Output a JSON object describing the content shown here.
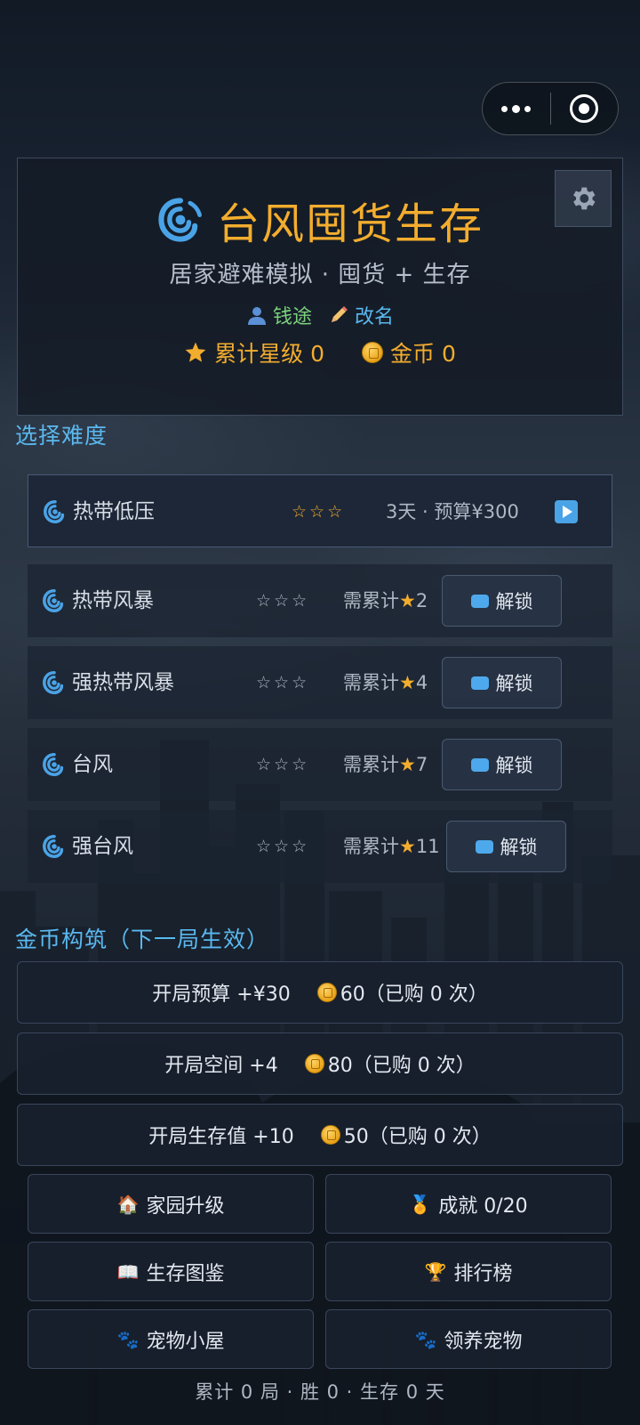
{
  "header": {
    "title": "台风囤货生存",
    "subtitle": "居家避难模拟 · 囤货 + 生存",
    "user_name": "钱途",
    "rename_label": "改名",
    "stars_label": "累计星级 0",
    "coins_label": "金币 0"
  },
  "difficulty": {
    "section_title": "选择难度",
    "levels": [
      {
        "name": "热带低压",
        "stars": "☆☆☆",
        "info": "3天 · 预算¥300",
        "state": "playable"
      },
      {
        "name": "热带风暴",
        "stars": "☆☆☆",
        "requirement_prefix": "需累计",
        "requirement_value": "2",
        "unlock_label": "解锁",
        "state": "locked"
      },
      {
        "name": "强热带风暴",
        "stars": "☆☆☆",
        "requirement_prefix": "需累计",
        "requirement_value": "4",
        "unlock_label": "解锁",
        "state": "locked"
      },
      {
        "name": "台风",
        "stars": "☆☆☆",
        "requirement_prefix": "需累计",
        "requirement_value": "7",
        "unlock_label": "解锁",
        "state": "locked"
      },
      {
        "name": "强台风",
        "stars": "☆☆☆",
        "requirement_prefix": "需累计",
        "requirement_value": "11",
        "unlock_label": "解锁",
        "state": "locked"
      }
    ]
  },
  "build": {
    "section_title": "金币构筑（下一局生效）",
    "items": [
      {
        "label": "开局预算 +¥30",
        "cost": "60（已购 0 次）"
      },
      {
        "label": "开局空间 +4",
        "cost": "80（已购 0 次）"
      },
      {
        "label": "开局生存值 +10",
        "cost": "50（已购 0 次）"
      }
    ]
  },
  "menu": {
    "home_upgrade": "家园升级",
    "achievements": "成就 0/20",
    "survival_guide": "生存图鉴",
    "leaderboard": "排行榜",
    "pet_house": "宠物小屋",
    "adopt_pet": "领养宠物"
  },
  "footer": {
    "summary": "累计 0 局 · 胜 0 · 生存 0 天"
  },
  "icons": {
    "menu": "more-dots-icon",
    "close": "target-icon",
    "settings": "gear-icon",
    "typhoon": "typhoon-icon",
    "user": "user-icon",
    "pencil": "pencil-icon",
    "star": "star-icon",
    "coin": "coin-icon",
    "ticket": "ticket-icon",
    "play": "play-icon",
    "house": "house-icon",
    "medal": "medal-icon",
    "book": "book-icon",
    "trophy": "trophy-icon",
    "paw": "paw-icon"
  },
  "colors": {
    "title": "#f3ad2e",
    "accent_blue": "#5ab8ef",
    "user_green": "#7bd07c"
  }
}
